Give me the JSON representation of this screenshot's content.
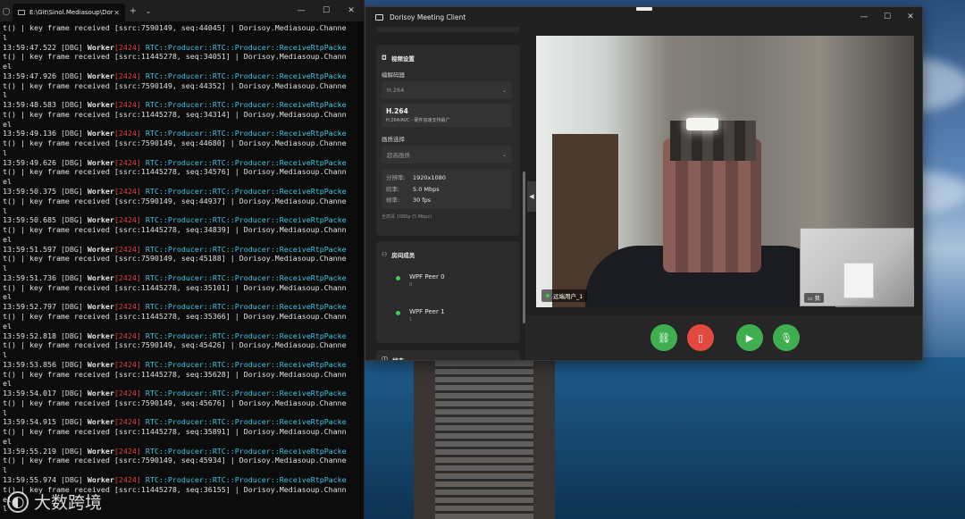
{
  "terminal": {
    "tab_title": "E:\\Git\\Sinol.Mediasoup\\Dorisc",
    "new_tab": "+",
    "lines": [
      [
        {
          "t": "t() | key frame received [ssrc:7590149, seq:44045] | Dorisoy.Mediasoup.Channe",
          "c": "white"
        }
      ],
      [
        {
          "t": "l",
          "c": "white"
        }
      ],
      [
        {
          "t": "13:59:47.522 ",
          "c": "time"
        },
        {
          "t": "[DBG] ",
          "c": "dbg"
        },
        {
          "t": "Worker",
          "c": "worker"
        },
        {
          "t": "[2424]",
          "c": "pid"
        },
        {
          "t": " RTC::Producer::RTC::Producer::ReceiveRtpPacke",
          "c": "cyan"
        }
      ],
      [
        {
          "t": "t() | key frame received [ssrc:11445278, seq:34051] | Dorisoy.Mediasoup.Chann",
          "c": "white"
        }
      ],
      [
        {
          "t": "el",
          "c": "white"
        }
      ],
      [
        {
          "t": "13:59:47.926 ",
          "c": "time"
        },
        {
          "t": "[DBG] ",
          "c": "dbg"
        },
        {
          "t": "Worker",
          "c": "worker"
        },
        {
          "t": "[2424]",
          "c": "pid"
        },
        {
          "t": " RTC::Producer::RTC::Producer::ReceiveRtpPacke",
          "c": "cyan"
        }
      ],
      [
        {
          "t": "t() | key frame received [ssrc:7590149, seq:44352] | Dorisoy.Mediasoup.Channe",
          "c": "white"
        }
      ],
      [
        {
          "t": "l",
          "c": "white"
        }
      ],
      [
        {
          "t": "13:59:48.583 ",
          "c": "time"
        },
        {
          "t": "[DBG] ",
          "c": "dbg"
        },
        {
          "t": "Worker",
          "c": "worker"
        },
        {
          "t": "[2424]",
          "c": "pid"
        },
        {
          "t": " RTC::Producer::RTC::Producer::ReceiveRtpPacke",
          "c": "cyan"
        }
      ],
      [
        {
          "t": "t() | key frame received [ssrc:11445278, seq:34314] | Dorisoy.Mediasoup.Chann",
          "c": "white"
        }
      ],
      [
        {
          "t": "el",
          "c": "white"
        }
      ],
      [
        {
          "t": "13:59:49.136 ",
          "c": "time"
        },
        {
          "t": "[DBG] ",
          "c": "dbg"
        },
        {
          "t": "Worker",
          "c": "worker"
        },
        {
          "t": "[2424]",
          "c": "pid"
        },
        {
          "t": " RTC::Producer::RTC::Producer::ReceiveRtpPacke",
          "c": "cyan"
        }
      ],
      [
        {
          "t": "t() | key frame received [ssrc:7590149, seq:44680] | Dorisoy.Mediasoup.Channe",
          "c": "white"
        }
      ],
      [
        {
          "t": "l",
          "c": "white"
        }
      ],
      [
        {
          "t": "13:59:49.626 ",
          "c": "time"
        },
        {
          "t": "[DBG] ",
          "c": "dbg"
        },
        {
          "t": "Worker",
          "c": "worker"
        },
        {
          "t": "[2424]",
          "c": "pid"
        },
        {
          "t": " RTC::Producer::RTC::Producer::ReceiveRtpPacke",
          "c": "cyan"
        }
      ],
      [
        {
          "t": "t() | key frame received [ssrc:11445278, seq:34576] | Dorisoy.Mediasoup.Chann",
          "c": "white"
        }
      ],
      [
        {
          "t": "el",
          "c": "white"
        }
      ],
      [
        {
          "t": "13:59:50.375 ",
          "c": "time"
        },
        {
          "t": "[DBG] ",
          "c": "dbg"
        },
        {
          "t": "Worker",
          "c": "worker"
        },
        {
          "t": "[2424]",
          "c": "pid"
        },
        {
          "t": " RTC::Producer::RTC::Producer::ReceiveRtpPacke",
          "c": "cyan"
        }
      ],
      [
        {
          "t": "t() | key frame received [ssrc:7590149, seq:44937] | Dorisoy.Mediasoup.Channe",
          "c": "white"
        }
      ],
      [
        {
          "t": "l",
          "c": "white"
        }
      ],
      [
        {
          "t": "13:59:50.685 ",
          "c": "time"
        },
        {
          "t": "[DBG] ",
          "c": "dbg"
        },
        {
          "t": "Worker",
          "c": "worker"
        },
        {
          "t": "[2424]",
          "c": "pid"
        },
        {
          "t": " RTC::Producer::RTC::Producer::ReceiveRtpPacke",
          "c": "cyan"
        }
      ],
      [
        {
          "t": "t() | key frame received [ssrc:11445278, seq:34839] | Dorisoy.Mediasoup.Chann",
          "c": "white"
        }
      ],
      [
        {
          "t": "el",
          "c": "white"
        }
      ],
      [
        {
          "t": "13:59:51.597 ",
          "c": "time"
        },
        {
          "t": "[DBG] ",
          "c": "dbg"
        },
        {
          "t": "Worker",
          "c": "worker"
        },
        {
          "t": "[2424]",
          "c": "pid"
        },
        {
          "t": " RTC::Producer::RTC::Producer::ReceiveRtpPacke",
          "c": "cyan"
        }
      ],
      [
        {
          "t": "t() | key frame received [ssrc:7590149, seq:45188] | Dorisoy.Mediasoup.Channe",
          "c": "white"
        }
      ],
      [
        {
          "t": "l",
          "c": "white"
        }
      ],
      [
        {
          "t": "13:59:51.736 ",
          "c": "time"
        },
        {
          "t": "[DBG] ",
          "c": "dbg"
        },
        {
          "t": "Worker",
          "c": "worker"
        },
        {
          "t": "[2424]",
          "c": "pid"
        },
        {
          "t": " RTC::Producer::RTC::Producer::ReceiveRtpPacke",
          "c": "cyan"
        }
      ],
      [
        {
          "t": "t() | key frame received [ssrc:11445278, seq:35101] | Dorisoy.Mediasoup.Chann",
          "c": "white"
        }
      ],
      [
        {
          "t": "el",
          "c": "white"
        }
      ],
      [
        {
          "t": "13:59:52.797 ",
          "c": "time"
        },
        {
          "t": "[DBG] ",
          "c": "dbg"
        },
        {
          "t": "Worker",
          "c": "worker"
        },
        {
          "t": "[2424]",
          "c": "pid"
        },
        {
          "t": " RTC::Producer::RTC::Producer::ReceiveRtpPacke",
          "c": "cyan"
        }
      ],
      [
        {
          "t": "t() | key frame received [ssrc:11445278, seq:35366] | Dorisoy.Mediasoup.Chann",
          "c": "white"
        }
      ],
      [
        {
          "t": "el",
          "c": "white"
        }
      ],
      [
        {
          "t": "13:59:52.818 ",
          "c": "time"
        },
        {
          "t": "[DBG] ",
          "c": "dbg"
        },
        {
          "t": "Worker",
          "c": "worker"
        },
        {
          "t": "[2424]",
          "c": "pid"
        },
        {
          "t": " RTC::Producer::RTC::Producer::ReceiveRtpPacke",
          "c": "cyan"
        }
      ],
      [
        {
          "t": "t() | key frame received [ssrc:7590149, seq:45426] | Dorisoy.Mediasoup.Channe",
          "c": "white"
        }
      ],
      [
        {
          "t": "l",
          "c": "white"
        }
      ],
      [
        {
          "t": "13:59:53.856 ",
          "c": "time"
        },
        {
          "t": "[DBG] ",
          "c": "dbg"
        },
        {
          "t": "Worker",
          "c": "worker"
        },
        {
          "t": "[2424]",
          "c": "pid"
        },
        {
          "t": " RTC::Producer::RTC::Producer::ReceiveRtpPacke",
          "c": "cyan"
        }
      ],
      [
        {
          "t": "t() | key frame received [ssrc:11445278, seq:35628] | Dorisoy.Mediasoup.Chann",
          "c": "white"
        }
      ],
      [
        {
          "t": "el",
          "c": "white"
        }
      ],
      [
        {
          "t": "13:59:54.017 ",
          "c": "time"
        },
        {
          "t": "[DBG] ",
          "c": "dbg"
        },
        {
          "t": "Worker",
          "c": "worker"
        },
        {
          "t": "[2424]",
          "c": "pid"
        },
        {
          "t": " RTC::Producer::RTC::Producer::ReceiveRtpPacke",
          "c": "cyan"
        }
      ],
      [
        {
          "t": "t() | key frame received [ssrc:7590149, seq:45676] | Dorisoy.Mediasoup.Channe",
          "c": "white"
        }
      ],
      [
        {
          "t": "l",
          "c": "white"
        }
      ],
      [
        {
          "t": "13:59:54.915 ",
          "c": "time"
        },
        {
          "t": "[DBG] ",
          "c": "dbg"
        },
        {
          "t": "Worker",
          "c": "worker"
        },
        {
          "t": "[2424]",
          "c": "pid"
        },
        {
          "t": " RTC::Producer::RTC::Producer::ReceiveRtpPacke",
          "c": "cyan"
        }
      ],
      [
        {
          "t": "t() | key frame received [ssrc:11445278, seq:35891] | Dorisoy.Mediasoup.Chann",
          "c": "white"
        }
      ],
      [
        {
          "t": "el",
          "c": "white"
        }
      ],
      [
        {
          "t": "13:59:55.219 ",
          "c": "time"
        },
        {
          "t": "[DBG] ",
          "c": "dbg"
        },
        {
          "t": "Worker",
          "c": "worker"
        },
        {
          "t": "[2424]",
          "c": "pid"
        },
        {
          "t": " RTC::Producer::RTC::Producer::ReceiveRtpPacke",
          "c": "cyan"
        }
      ],
      [
        {
          "t": "t() | key frame received [ssrc:7590149, seq:45934] | Dorisoy.Mediasoup.Channe",
          "c": "white"
        }
      ],
      [
        {
          "t": "l",
          "c": "white"
        }
      ],
      [
        {
          "t": "13:59:55.974 ",
          "c": "time"
        },
        {
          "t": "[DBG] ",
          "c": "dbg"
        },
        {
          "t": "Worker",
          "c": "worker"
        },
        {
          "t": "[2424]",
          "c": "pid"
        },
        {
          "t": " RTC::Producer::RTC::Producer::ReceiveRtpPacke",
          "c": "cyan"
        }
      ],
      [
        {
          "t": "t() | key frame received [ssrc:11445278, seq:36155] | Dorisoy.Mediasoup.Chann",
          "c": "white"
        }
      ],
      [
        {
          "t": "el",
          "c": "white"
        }
      ],
      [
        {
          "t": "l",
          "c": "white"
        }
      ]
    ],
    "colors": {
      "cyan": "#3fc7e6",
      "pid": "#e04040",
      "background": "#0c0c0c"
    }
  },
  "client": {
    "title": "Dorisoy Meeting Client",
    "video_params": {
      "section_title": "视频设置",
      "codec_label": "编解码器",
      "codec_value": "H.264",
      "codec_name": "H.264",
      "codec_desc": "H.264/AVC - 硬件加速支持最广",
      "quality_label": "画质选择",
      "quality_value": "超高画质",
      "resolution_key": "分辨率:",
      "resolution_value": "1920x1080",
      "bitrate_key": "码率:",
      "bitrate_value": "5.0 Mbps",
      "framerate_key": "帧率:",
      "framerate_value": "30 fps",
      "quality_note": "全高清 1080p (5 Mbps)"
    },
    "members": {
      "section_title": "房间成员",
      "peers": [
        {
          "name": "WPF Peer 0",
          "id": "0"
        },
        {
          "name": "WPF Peer 1",
          "id": "1"
        }
      ]
    },
    "status": {
      "section_title": "状态"
    },
    "video": {
      "remote_label": "远端用户_1",
      "local_label": "我"
    },
    "accent_green": "#3fae4e",
    "accent_red": "#e14a3c"
  },
  "watermark": {
    "text": "大数跨境"
  }
}
